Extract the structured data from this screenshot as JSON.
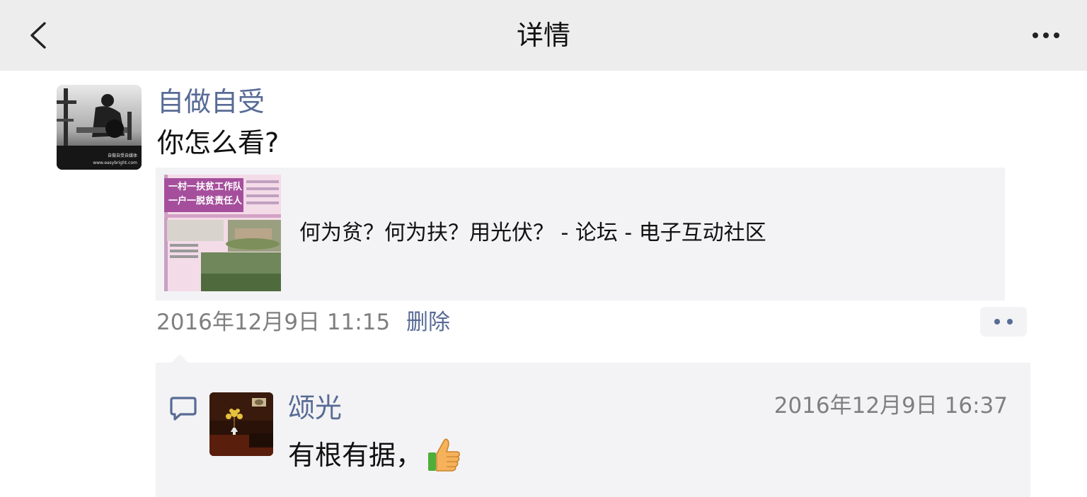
{
  "nav": {
    "title": "详情"
  },
  "post": {
    "author": "自做自受",
    "text": "你怎么看?",
    "avatar_caption": [
      "自做自受自媒体",
      "www.easybright.com"
    ],
    "link": {
      "title": "何为贫？何为扶？用光伏？ - 论坛 - 电子互动社区",
      "thumb_headline": [
        "一村一扶贫工作队",
        "一户一脱贫责任人"
      ]
    },
    "time": "2016年12月9日 11:15",
    "delete_label": "删除"
  },
  "comment": {
    "author": "颂光",
    "time": "2016年12月9日 16:37",
    "text": "有根有据，"
  },
  "colors": {
    "link": "#576b95",
    "navbar": "#ededed",
    "panel": "#f3f3f5"
  }
}
